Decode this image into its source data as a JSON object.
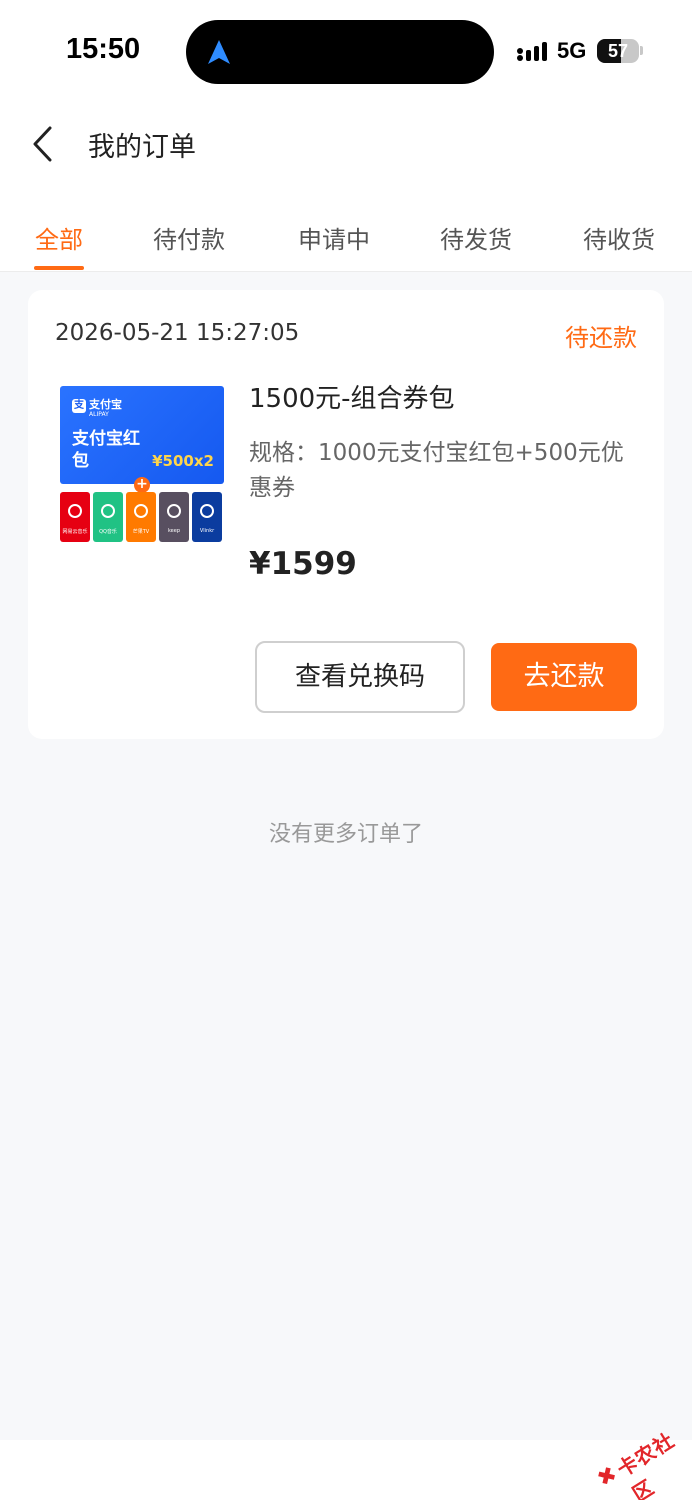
{
  "status_bar": {
    "time": "15:50",
    "network": "5G",
    "battery": "57",
    "battery_level": 0.57
  },
  "header": {
    "title": "我的订单"
  },
  "tabs": [
    {
      "label": "全部",
      "active": true
    },
    {
      "label": "待付款",
      "active": false
    },
    {
      "label": "申请中",
      "active": false
    },
    {
      "label": "待发货",
      "active": false
    },
    {
      "label": "待收货",
      "active": false
    }
  ],
  "order": {
    "time": "2026-05-21 15:27:05",
    "status": "待还款",
    "product": {
      "name": "1500元-组合券包",
      "spec": "规格：1000元支付宝红包+500元优惠券",
      "price": "¥1599",
      "thumbnail": {
        "brand": "支付宝",
        "brand_sub": "ALIPAY",
        "title": "支付宝红包",
        "amount": "¥500x2",
        "tiles": [
          {
            "label": "网易云音乐",
            "color": "#e60012"
          },
          {
            "label": "QQ音乐",
            "color": "#20c284"
          },
          {
            "label": "芒果TV",
            "color": "#ff7a00"
          },
          {
            "label": "keep",
            "color": "#584f60"
          },
          {
            "label": "Vlinkr",
            "color": "#0b3c9f"
          }
        ]
      }
    },
    "buttons": {
      "view_code": "查看兑换码",
      "repay": "去还款"
    }
  },
  "footer": {
    "no_more": "没有更多订单了"
  },
  "watermark": {
    "text": "卡农社区"
  },
  "colors": {
    "accent": "#ff6a14",
    "background": "#f7f8fa"
  }
}
